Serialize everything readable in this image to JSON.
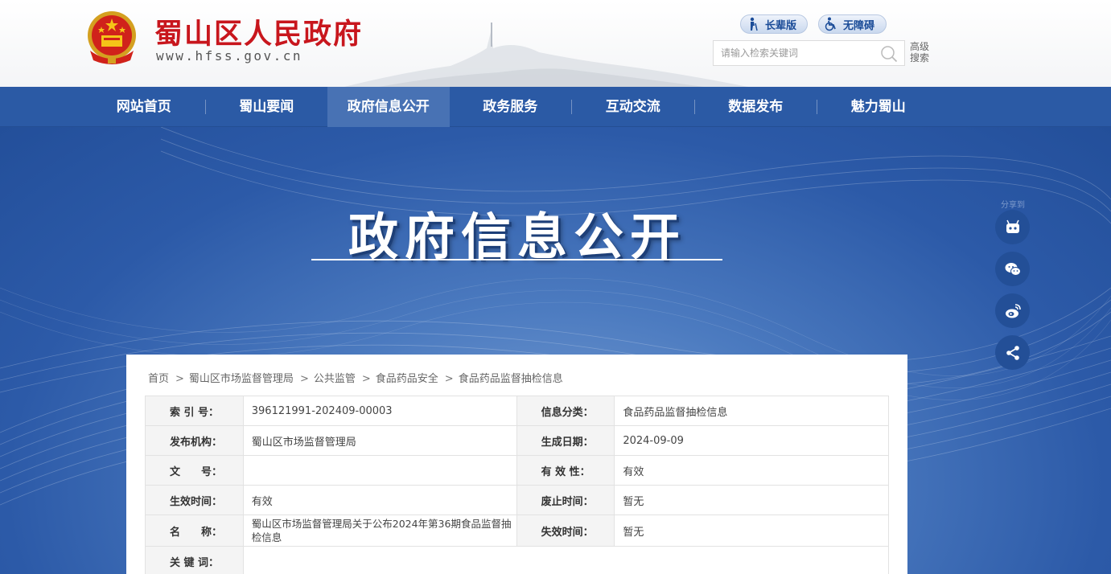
{
  "header": {
    "site_title": "蜀山区人民政府",
    "site_url": "www.hfss.gov.cn",
    "elder_mode": "长辈版",
    "accessibility_mode": "无障碍",
    "search_placeholder": "请输入检索关键词",
    "advanced_search": "高级搜索",
    "brand_color": "#c8161d"
  },
  "nav": {
    "items": [
      {
        "label": "网站首页"
      },
      {
        "label": "蜀山要闻"
      },
      {
        "label": "政府信息公开",
        "active": true
      },
      {
        "label": "政务服务"
      },
      {
        "label": "互动交流"
      },
      {
        "label": "数据发布"
      },
      {
        "label": "魅力蜀山"
      }
    ],
    "color": "#2b5aa5"
  },
  "banner": {
    "title": "政府信息公开"
  },
  "side_share": {
    "label": "分享到",
    "buttons": [
      "robot-icon",
      "wechat-icon",
      "weibo-icon",
      "share-icon"
    ]
  },
  "breadcrumb": [
    "首页",
    "蜀山区市场监督管理局",
    "公共监管",
    "食品药品安全",
    "食品药品监督抽检信息"
  ],
  "info": {
    "index_no_label": "索 引 号：",
    "index_no": "396121991-202409-00003",
    "category_label": "信息分类：",
    "category": "食品药品监督抽检信息",
    "publisher_label": "发布机构：",
    "publisher": "蜀山区市场监督管理局",
    "gen_date_label": "生成日期：",
    "gen_date": "2024-09-09",
    "doc_no_label": "文　　号：",
    "doc_no": "",
    "validity_label": "有 效 性：",
    "validity": "有效",
    "effective_label": "生效时间：",
    "effective": "有效",
    "repeal_label": "废止时间：",
    "repeal": "暂无",
    "name_label": "名　　称：",
    "name": "蜀山区市场监督管理局关于公布2024年第36期食品监督抽检信息",
    "invalid_label": "失效时间：",
    "invalid": "暂无",
    "keywords_label": "关 键 词：",
    "keywords": ""
  }
}
